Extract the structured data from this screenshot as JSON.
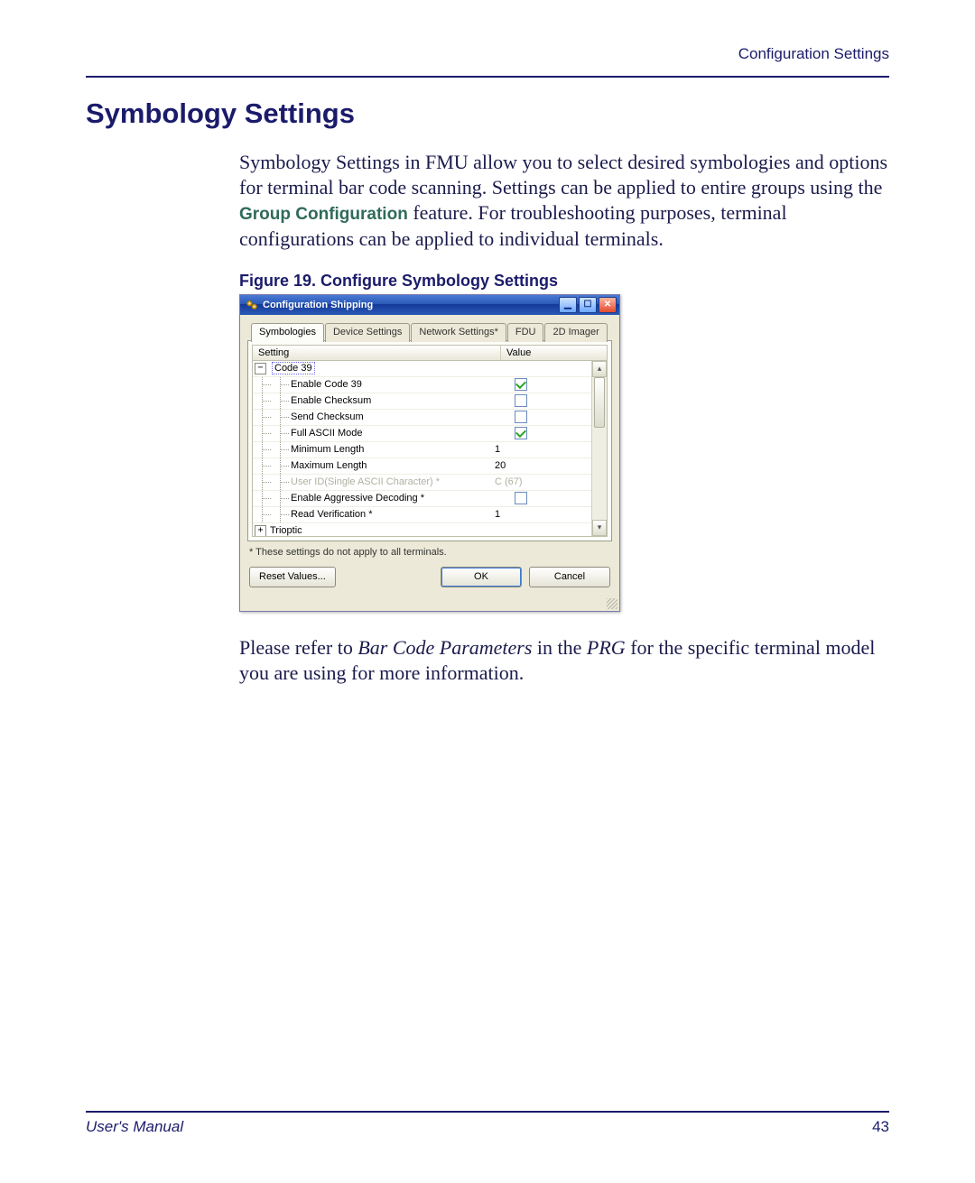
{
  "header": {
    "section": "Configuration Settings"
  },
  "title": "Symbology Settings",
  "intro": {
    "part1": "Symbology Settings in FMU allow you to select desired symbologies and options for terminal bar code scanning. Settings can be applied to entire groups using the ",
    "group_term": "Group Configuration",
    "part2": " feature. For troubleshooting purposes, terminal configurations can be applied to individual terminals."
  },
  "figure": {
    "caption": "Figure 19. Configure Symbology Settings"
  },
  "dialog": {
    "title": "Configuration Shipping",
    "tabs": [
      "Symbologies",
      "Device Settings",
      "Network Settings*",
      "FDU",
      "2D Imager"
    ],
    "columns": {
      "setting": "Setting",
      "value": "Value"
    },
    "tree": {
      "code39": {
        "label": "Code 39",
        "expanded": true,
        "items": [
          {
            "label": "Enable Code 39",
            "type": "checkbox",
            "checked": true
          },
          {
            "label": "Enable Checksum",
            "type": "checkbox",
            "checked": false
          },
          {
            "label": "Send Checksum",
            "type": "checkbox",
            "checked": false
          },
          {
            "label": "Full ASCII Mode",
            "type": "checkbox",
            "checked": true
          },
          {
            "label": "Minimum Length",
            "type": "number",
            "value": "1"
          },
          {
            "label": "Maximum Length",
            "type": "number",
            "value": "20"
          },
          {
            "label": "User ID(Single ASCII Character) *",
            "type": "text",
            "value": "C (67)",
            "disabled": true
          },
          {
            "label": "Enable Aggressive Decoding *",
            "type": "checkbox",
            "checked": false
          },
          {
            "label": "Read Verification *",
            "type": "number",
            "value": "1"
          }
        ]
      },
      "trioptic": {
        "label": "Trioptic",
        "expanded": false
      }
    },
    "note": "* These settings do not apply to all terminals.",
    "buttons": {
      "reset": "Reset Values...",
      "ok": "OK",
      "cancel": "Cancel"
    }
  },
  "closing": {
    "part1": "Please refer to ",
    "ital1": "Bar Code Parameters",
    "part2": " in the ",
    "ital2": "PRG",
    "part3": " for the specific terminal model you are using for more information."
  },
  "footer": {
    "manual": "User's Manual",
    "page": "43"
  }
}
